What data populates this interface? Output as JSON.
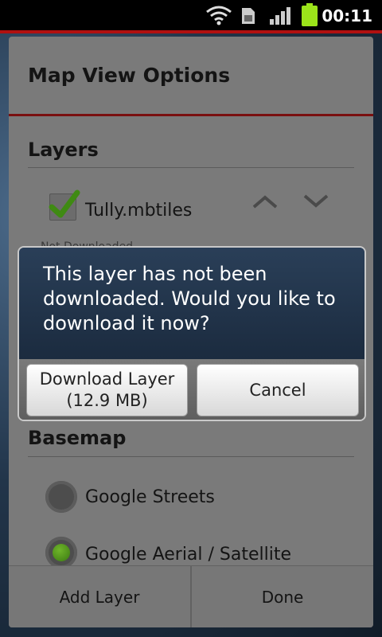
{
  "status_bar": {
    "time": "00:11",
    "battery_color": "#9be41a"
  },
  "sheet": {
    "title": "Map View Options",
    "layers_header": "Layers",
    "layer": {
      "name": "Tully.mbtiles",
      "checked": true,
      "subtext": "Not Downloaded"
    },
    "basemap_header": "Basemap",
    "basemaps": [
      {
        "label": "Google Streets",
        "selected": false
      },
      {
        "label": "Google Aerial / Satellite",
        "selected": true
      }
    ],
    "bottom": {
      "add_layer": "Add Layer",
      "done": "Done"
    }
  },
  "dialog": {
    "message": "This layer has not been downloaded. Would you like to download it now?",
    "download_line1": "Download Layer",
    "download_line2": "(12.9 MB)",
    "cancel": "Cancel"
  }
}
